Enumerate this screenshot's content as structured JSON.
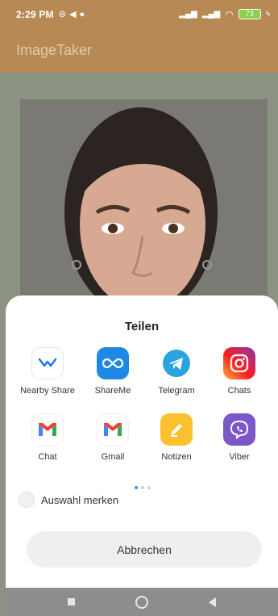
{
  "status_bar": {
    "time": "2:29 PM",
    "left_icons": [
      "alarm-icon",
      "location-arrow-icon",
      "sync-icon"
    ],
    "right_icons": [
      "signal-icon",
      "signal-icon",
      "wifi-icon",
      "battery-icon",
      "charging-icon"
    ],
    "battery_level": "73"
  },
  "app_bar": {
    "title": "ImageTaker"
  },
  "share_sheet": {
    "title": "Teilen",
    "apps": [
      {
        "label": "Nearby Share",
        "icon": "nearby-share-icon"
      },
      {
        "label": "ShareMe",
        "icon": "shareme-icon",
        "color": "#1e88e5"
      },
      {
        "label": "Telegram",
        "icon": "telegram-icon",
        "color": "#2aa3e0"
      },
      {
        "label": "Chats",
        "icon": "instagram-icon"
      },
      {
        "label": "Chat",
        "icon": "gmail-icon"
      },
      {
        "label": "Gmail",
        "icon": "gmail-icon"
      },
      {
        "label": "Notizen",
        "icon": "notes-icon",
        "color": "#fbc02d"
      },
      {
        "label": "Viber",
        "icon": "viber-icon",
        "color": "#7b57c8"
      }
    ],
    "page_indicator": {
      "pages": 3,
      "current": 1
    },
    "remember_label": "Auswahl merken",
    "cancel_label": "Abbrechen"
  },
  "nav_bar": {
    "icons": [
      "recents-icon",
      "home-icon",
      "back-icon"
    ]
  }
}
